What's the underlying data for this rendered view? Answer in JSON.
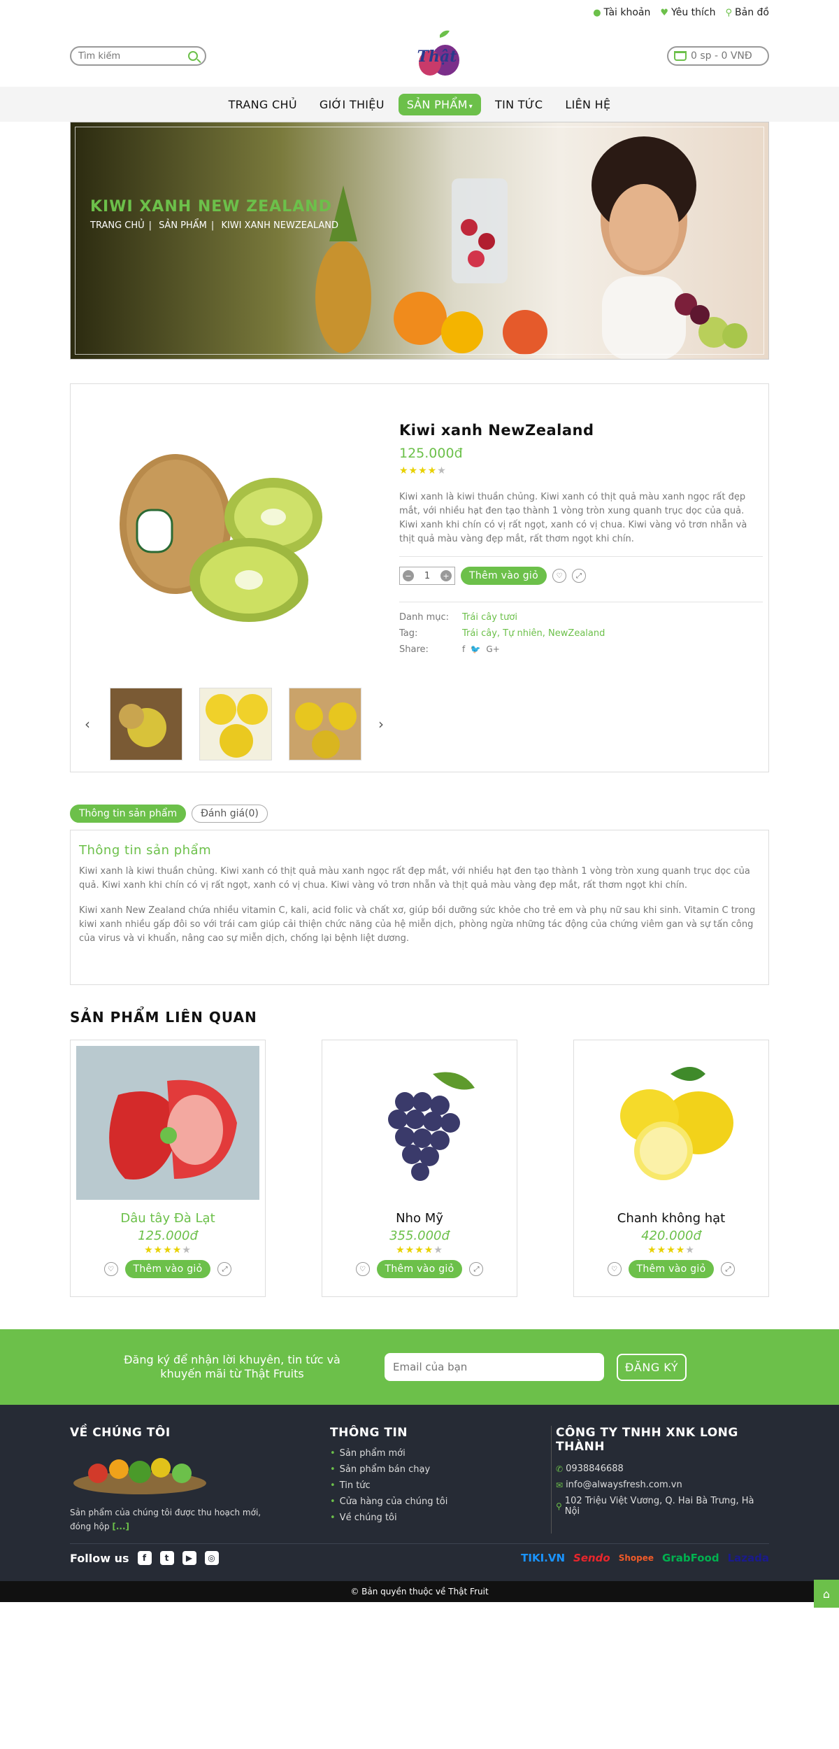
{
  "topbar": {
    "account": "Tài khoản",
    "wishlist": "Yêu thích",
    "map": "Bản đồ"
  },
  "header": {
    "search_placeholder": "Tìm kiếm",
    "cart": "0 sp - 0 VNĐ",
    "logo_text": "Thật"
  },
  "nav": [
    {
      "label": "TRANG CHỦ"
    },
    {
      "label": "GIỚI THIỆU"
    },
    {
      "label": "SẢN PHẨM",
      "active": true
    },
    {
      "label": "TIN TỨC"
    },
    {
      "label": "LIÊN HỆ"
    }
  ],
  "hero": {
    "title": "KIWI XANH NEW ZEALAND",
    "breadcrumb": [
      "TRANG CHỦ",
      "SẢN PHẨM",
      "KIWI XANH NEWZEALAND"
    ]
  },
  "product": {
    "name": "Kiwi xanh NewZealand",
    "price": "125.000đ",
    "rating": 4,
    "description": "Kiwi xanh là kiwi thuần chủng. Kiwi xanh có thịt quả màu xanh ngọc rất đẹp mắt, với nhiều hạt đen tạo thành 1 vòng tròn xung quanh trục dọc của quả. Kiwi xanh khi chín có vị rất ngọt, xanh có vị chua. Kiwi vàng vỏ trơn nhẵn và thịt quả màu vàng đẹp mắt, rất thơm ngọt khi chín.",
    "quantity": "1",
    "add_to_cart": "Thêm vào giỏ",
    "category_label": "Danh mục:",
    "category_value": "Trái cây tươi",
    "tag_label": "Tag:",
    "tag_value": "Trái cây, Tự nhiên, NewZealand",
    "share_label": "Share:",
    "share_icons": "f  ✔  G+"
  },
  "tabs": [
    {
      "label": "Thông tin sản phẩm",
      "active": true
    },
    {
      "label": "Đánh giá(0)"
    }
  ],
  "tab_content": {
    "title": "Thông tin sản phẩm",
    "p1": "Kiwi xanh là kiwi thuần chủng. Kiwi xanh có thịt quả màu xanh ngọc rất đẹp mắt, với nhiều hạt đen tạo thành 1 vòng tròn xung quanh trục dọc của quả. Kiwi xanh khi chín có vị rất ngọt, xanh có vị chua. Kiwi vàng vỏ trơn nhẵn và thịt quả màu vàng đẹp mắt, rất thơm ngọt khi chín.",
    "p2": "Kiwi xanh New Zealand chứa nhiều vitamin C, kali, acid folic và chất xơ, giúp bồi dưỡng sức khỏe cho trẻ em và phụ nữ sau khi sinh. Vitamin C trong kiwi xanh nhiều gấp đôi so với trái cam giúp cải thiện chức năng của hệ miễn dịch, phòng ngừa những tác động của chứng viêm gan và sự tấn công của virus và vi khuẩn, nâng cao sự miễn dịch, chống lại bệnh liệt dương."
  },
  "related": {
    "title": "SẢN PHẨM LIÊN QUAN",
    "items": [
      {
        "name": "Dâu tây Đà Lạt",
        "price": "125.000đ",
        "rating": 4,
        "button": "Thêm vào giỏ",
        "highlight": true
      },
      {
        "name": "Nho Mỹ",
        "price": "355.000đ",
        "rating": 4,
        "button": "Thêm vào giỏ"
      },
      {
        "name": "Chanh không hạt",
        "price": "420.000đ",
        "rating": 4,
        "button": "Thêm vào giỏ"
      }
    ]
  },
  "newsletter": {
    "text": "Đăng ký để nhận lời khuyên, tin tức và khuyến mãi từ Thật Fruits",
    "placeholder": "Email của bạn",
    "button": "ĐĂNG KÝ"
  },
  "footer": {
    "about_title": "VỀ CHÚNG TÔI",
    "about_text": "Sản phẩm của chúng tôi được thu hoạch mới, đóng hộp",
    "about_more": "[...]",
    "info_title": "THÔNG TIN",
    "info_links": [
      "Sản phẩm mới",
      "Sản phẩm bán chạy",
      "Tin tức",
      "Cửa hàng của chúng tôi",
      "Về chúng tôi"
    ],
    "company_title": "CÔNG TY TNHH XNK LONG THÀNH",
    "phone": "0938846688",
    "email": "info@alwaysfresh.com.vn",
    "address": "102 Triệu Việt Vương, Q. Hai Bà Trưng, Hà Nội",
    "follow": "Follow us",
    "partners": [
      "TIKI.VN",
      "Sendo",
      "Shopee",
      "GrabFood",
      "Lazada"
    ],
    "copyright": "© Bản quyền thuộc về Thật Fruit"
  },
  "colors": {
    "accent": "#6cc04a",
    "footer_bg": "#262b35"
  }
}
